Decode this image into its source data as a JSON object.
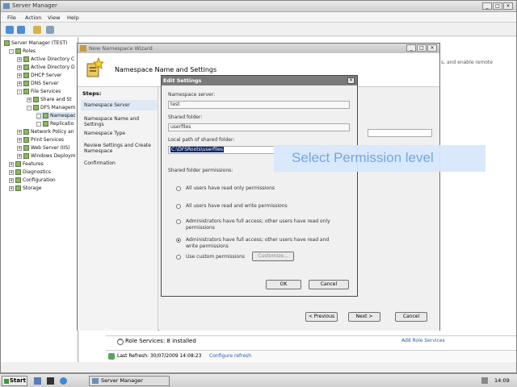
{
  "server_manager": {
    "title": "Server Manager",
    "menu": [
      "File",
      "Action",
      "View",
      "Help"
    ],
    "tree": [
      {
        "label": "Server Manager (TEST)",
        "level": 0
      },
      {
        "label": "Roles",
        "level": 1
      },
      {
        "label": "Active Directory C",
        "level": 2
      },
      {
        "label": "Active Directory D",
        "level": 2
      },
      {
        "label": "DHCP Server",
        "level": 2
      },
      {
        "label": "DNS Server",
        "level": 2
      },
      {
        "label": "File Services",
        "level": 2
      },
      {
        "label": "Share and St",
        "level": 3
      },
      {
        "label": "DFS Managem",
        "level": 3
      },
      {
        "label": "Namespac",
        "level": 4
      },
      {
        "label": "Replicatio",
        "level": 4
      },
      {
        "label": "Network Policy an",
        "level": 2
      },
      {
        "label": "Print Services",
        "level": 2
      },
      {
        "label": "Web Server (IIS)",
        "level": 2
      },
      {
        "label": "Windows Deploym",
        "level": 2
      },
      {
        "label": "Features",
        "level": 1
      },
      {
        "label": "Diagnostics",
        "level": 1
      },
      {
        "label": "Configuration",
        "level": 1
      },
      {
        "label": "Storage",
        "level": 1
      }
    ],
    "content_right_text": "s, and enable remote",
    "role_services_label": "Role Services: 8 installed",
    "add_role_services_link": "Add Role Services",
    "last_refresh": "Last Refresh: 30/07/2009 14:08:23",
    "configure_refresh": "Configure refresh"
  },
  "wizard": {
    "title": "New Namespace Wizard",
    "heading": "Namespace Name and Settings",
    "steps_label": "Steps:",
    "steps": [
      "Namespace Server",
      "Namespace Name and Settings",
      "Namespace Type",
      "Review Settings and Create Namespace",
      "Confirmation"
    ],
    "buttons": {
      "previous": "< Previous",
      "next": "Next >",
      "cancel": "Cancel"
    }
  },
  "edit_settings": {
    "title": "Edit Settings",
    "namespace_server_label": "Namespace server:",
    "namespace_server_value": "test",
    "shared_folder_label": "Shared folder:",
    "shared_folder_value": "userfiles",
    "local_path_label": "Local path of shared folder:",
    "local_path_value": "C:\\DFSRoots\\userfiles",
    "permissions_label": "Shared folder permissions:",
    "options": [
      {
        "text": "All users have read only permissions",
        "selected": false
      },
      {
        "text": "All users have read and write permissions",
        "selected": false
      },
      {
        "text": "Administrators have full access; other users have read only permissions",
        "selected": false
      },
      {
        "text": "Administrators have full access; other users have read and write permissions",
        "selected": true
      },
      {
        "text": "Use custom permissions",
        "selected": false
      }
    ],
    "customize_label": "Customize...",
    "ok_label": "OK",
    "cancel_label": "Cancel"
  },
  "callout": {
    "text": "Select Permission level"
  },
  "taskbar": {
    "start": "Start",
    "task": "Server Manager",
    "clock": "14:09"
  }
}
